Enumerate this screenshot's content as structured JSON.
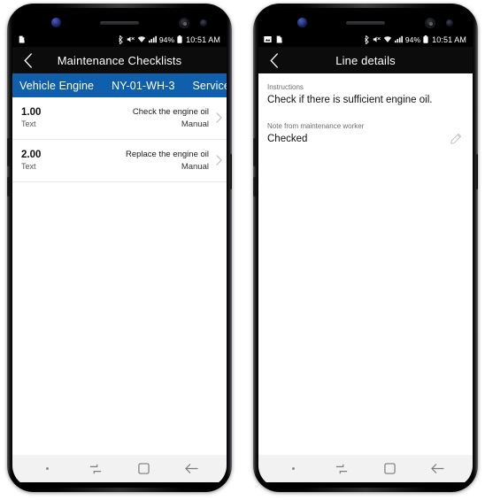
{
  "phones": [
    {
      "id": "phone-left",
      "status_bar": {
        "left_icons": [
          "screenshot-icon"
        ],
        "bluetooth_icon": "bluetooth-icon",
        "mute_icon": "mute-icon",
        "wifi_icon": "wifi-icon",
        "signal_icon": "signal-icon",
        "battery_percent": "94%",
        "battery_icon": "battery-icon",
        "time": "10:51 AM"
      },
      "app_bar": {
        "back_icon": "back-chevron-icon",
        "title": "Maintenance Checklists"
      },
      "breadcrumb": {
        "background_color": "#0f5fad",
        "items": [
          "Vehicle Engine",
          "NY-01-WH-3",
          "Service"
        ]
      },
      "rows": [
        {
          "number": "1.00",
          "type": "Text",
          "title": "Check the engine oil",
          "meta": "Manual",
          "chevron_icon": "chevron-right-icon"
        },
        {
          "number": "2.00",
          "type": "Text",
          "title": "Replace the engine oil",
          "meta": "Manual",
          "chevron_icon": "chevron-right-icon"
        }
      ],
      "nav_bar": {
        "dot_icon": "recents-dot-icon",
        "recents_icon": "recents-icon",
        "home_icon": "home-square-icon",
        "back_icon": "back-arrow-icon"
      }
    },
    {
      "id": "phone-right",
      "status_bar": {
        "left_icons": [
          "image-icon",
          "screenshot-icon"
        ],
        "bluetooth_icon": "bluetooth-icon",
        "mute_icon": "mute-icon",
        "wifi_icon": "wifi-icon",
        "signal_icon": "signal-icon",
        "battery_percent": "94%",
        "battery_icon": "battery-icon",
        "time": "10:51 AM"
      },
      "app_bar": {
        "back_icon": "back-chevron-icon",
        "title": "Line details"
      },
      "fields": [
        {
          "label": "Instructions",
          "value": "Check if there is sufficient engine oil.",
          "editable": false
        },
        {
          "label": "Note from maintenance worker",
          "value": "Checked",
          "editable": true,
          "edit_icon": "pencil-icon"
        }
      ],
      "nav_bar": {
        "dot_icon": "recents-dot-icon",
        "recents_icon": "recents-icon",
        "home_icon": "home-square-icon",
        "back_icon": "back-arrow-icon"
      }
    }
  ]
}
